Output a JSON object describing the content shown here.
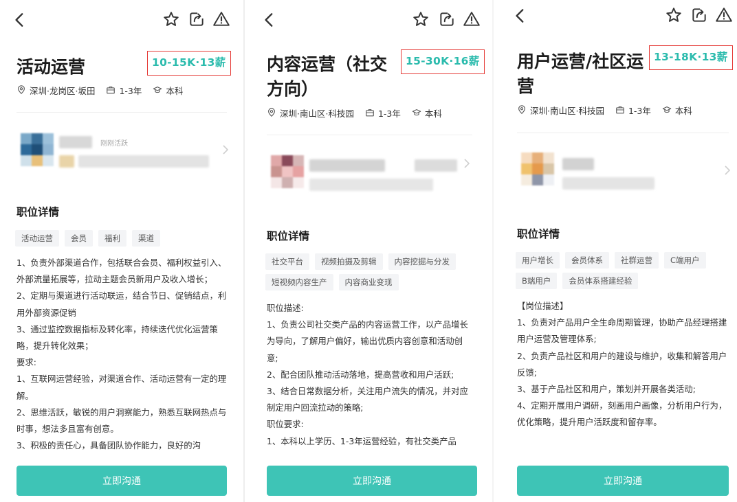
{
  "colors": {
    "accent": "#3ec4b6",
    "salary_text": "#2bbbad",
    "highlight_box": "#e53935"
  },
  "icons": [
    "back-arrow-icon",
    "star-icon",
    "share-icon",
    "warning-icon",
    "location-icon",
    "briefcase-icon",
    "education-icon",
    "chevron-right-icon"
  ],
  "panels": [
    {
      "title": "活动运营",
      "salary": "10-15K·13薪",
      "location": "深圳·龙岗区·坂田",
      "experience": "1-3年",
      "education": "本科",
      "recruiter_status": "刚刚活跃",
      "section_title": "职位详情",
      "tags": [
        "活动运营",
        "会员",
        "福利",
        "渠道"
      ],
      "description": [
        "1、负责外部渠道合作，包括联合会员、福利权益引入、外部流量拓展等，拉动主题会员新用户及收入增长；",
        "2、定期与渠道进行活动联运，结合节日、促销结点，利用外部资源促销",
        "3、通过监控数据指标及转化率，持续迭代优化运营策略，提升转化效果；",
        "要求:",
        "1、互联网运营经验，对渠道合作、活动运营有一定的理解。",
        "2、思维活跃，敏锐的用户洞察能力，熟悉互联网热点与时事，想法多且富有创意。",
        "3、积极的责任心，具备团队协作能力，良好的沟"
      ],
      "cta_label": "立即沟通"
    },
    {
      "title": "内容运营（社交方向）",
      "salary": "15-30K·16薪",
      "location": "深圳·南山区·科技园",
      "experience": "1-3年",
      "education": "本科",
      "section_title": "职位详情",
      "tags": [
        "社交平台",
        "视频拍摄及剪辑",
        "内容挖掘与分发",
        "短视频内容生产",
        "内容商业变现"
      ],
      "description": [
        "职位描述:",
        "1、负责公司社交类产品的内容运营工作，以产品增长为导向，了解用户偏好，输出优质内容创意和活动创意;",
        "2、配合团队推动活动落地，提高营收和用户活跃;",
        "3、结合日常数据分析，关注用户流失的情况，并对应制定用户回流拉动的策略;",
        "职位要求:",
        "1、本科以上学历、1-3年运营经验，有社交类产品"
      ],
      "cta_label": "立即沟通"
    },
    {
      "title": "用户运营/社区运营",
      "salary": "13-18K·13薪",
      "location": "深圳·南山区·科技园",
      "experience": "1-3年",
      "education": "本科",
      "section_title": "职位详情",
      "tags": [
        "用户增长",
        "会员体系",
        "社群运营",
        "C端用户",
        "B端用户",
        "会员体系搭建经验"
      ],
      "description": [
        "【岗位描述】",
        "1、负责对产品用户全生命周期管理，协助产品经理搭建用户运营及管理体系;",
        "2、负责产品社区和用户的建设与维护，收集和解答用户反馈;",
        "3、基于产品社区和用户，策划并开展各类活动;",
        "4、定期开展用户调研，刻画用户画像，分析用户行为，优化策略，提升用户活跃度和留存率。"
      ],
      "cta_label": "立即沟通"
    }
  ]
}
